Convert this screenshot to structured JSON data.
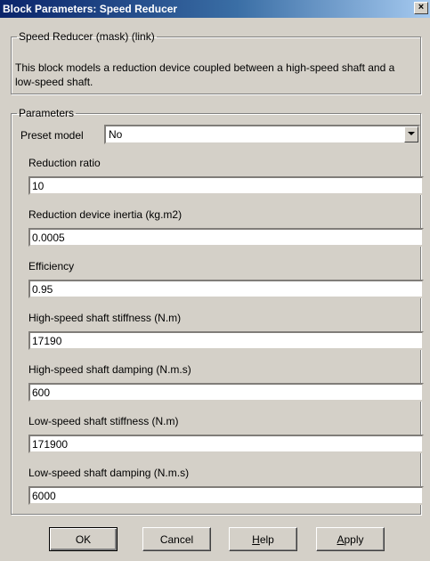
{
  "window": {
    "title": "Block Parameters: Speed Reducer",
    "close_symbol": "×"
  },
  "description_group": {
    "legend": "Speed Reducer (mask) (link)",
    "text": "This block models a reduction device coupled between a high-speed shaft and a low-speed shaft."
  },
  "parameters": {
    "legend": "Parameters",
    "preset_label": "Preset model",
    "preset_value": "No",
    "fields": [
      {
        "label": "Reduction ratio",
        "value": "10"
      },
      {
        "label": "Reduction device inertia (kg.m2)",
        "value": "0.0005"
      },
      {
        "label": "Efficiency",
        "value": "0.95"
      },
      {
        "label": "High-speed shaft stiffness (N.m)",
        "value": "17190"
      },
      {
        "label": "High-speed shaft damping (N.m.s)",
        "value": "600"
      },
      {
        "label": "Low-speed shaft stiffness (N.m)",
        "value": "171900"
      },
      {
        "label": "Low-speed shaft damping (N.m.s)",
        "value": "6000"
      }
    ]
  },
  "buttons": {
    "ok": "OK",
    "cancel": "Cancel",
    "help": "Help",
    "apply": "Apply"
  },
  "icons": {
    "close": "close-icon",
    "dropdown": "chevron-down-icon"
  }
}
